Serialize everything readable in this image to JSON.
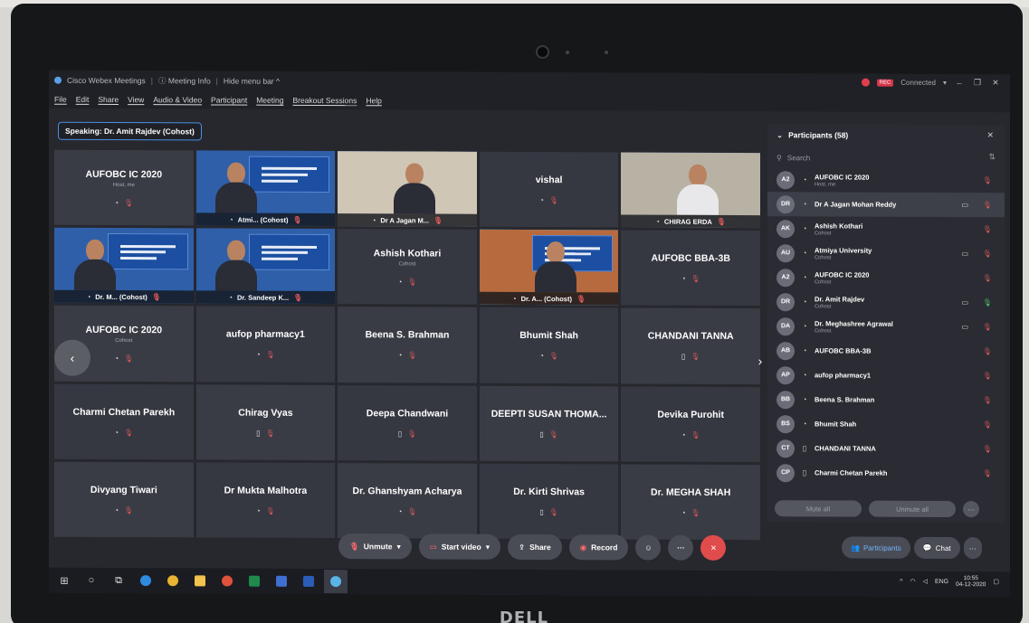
{
  "titlebar": {
    "app_name": "Cisco Webex Meetings",
    "meeting_info": "Meeting Info",
    "hide_menu_bar": "Hide menu bar",
    "connection_status": "Connected",
    "rec_badge": "REC"
  },
  "menubar": [
    "File",
    "Edit",
    "Share",
    "View",
    "Audio & Video",
    "Participant",
    "Meeting",
    "Breakout Sessions",
    "Help"
  ],
  "speaking_label": "Speaking: Dr. Amit Rajdev (Cohost)",
  "tiles": [
    {
      "name": "AUFOBC IC 2020",
      "sub": "Host, me",
      "kind": "avatar"
    },
    {
      "name": "Atmi... (Cohost)",
      "kind": "video"
    },
    {
      "name": "Dr A Jagan M...",
      "kind": "video"
    },
    {
      "name": "vishal",
      "kind": "avatar"
    },
    {
      "name": "CHIRAG ERDA",
      "kind": "video"
    },
    {
      "name": "Dr. M... (Cohost)",
      "kind": "video"
    },
    {
      "name": "Dr. Sandeep K...",
      "kind": "video"
    },
    {
      "name": "Ashish Kothari",
      "sub": "Cohost",
      "kind": "avatar"
    },
    {
      "name": "Dr. A... (Cohost)",
      "kind": "video"
    },
    {
      "name": "AUFOBC BBA-3B",
      "kind": "avatar"
    },
    {
      "name": "AUFOBC IC 2020",
      "sub": "Cohost",
      "kind": "avatar"
    },
    {
      "name": "aufop pharmacy1",
      "kind": "avatar"
    },
    {
      "name": "Beena S. Brahman",
      "kind": "avatar"
    },
    {
      "name": "Bhumit Shah",
      "kind": "avatar"
    },
    {
      "name": "CHANDANI TANNA",
      "kind": "avatar"
    },
    {
      "name": "Charmi Chetan Parekh",
      "kind": "avatar"
    },
    {
      "name": "Chirag Vyas",
      "kind": "avatar"
    },
    {
      "name": "Deepa Chandwani",
      "kind": "avatar"
    },
    {
      "name": "DEEPTI SUSAN THOMA...",
      "kind": "avatar"
    },
    {
      "name": "Devika Purohit",
      "kind": "avatar"
    },
    {
      "name": "Divyang Tiwari",
      "kind": "avatar"
    },
    {
      "name": "Dr Mukta Malhotra",
      "kind": "avatar"
    },
    {
      "name": "Dr. Ghanshyam Acharya",
      "kind": "avatar"
    },
    {
      "name": "Dr. Kirti Shrivas",
      "kind": "avatar"
    },
    {
      "name": "Dr. MEGHA SHAH",
      "kind": "avatar"
    }
  ],
  "panel": {
    "title": "Participants (58)",
    "search_placeholder": "Search",
    "mute_all": "Mute all",
    "unmute_all": "Unmute all",
    "participants": [
      {
        "initials": "A2",
        "name": "AUFOBC IC 2020",
        "role": "Host, me"
      },
      {
        "initials": "DR",
        "name": "Dr A Jagan Mohan Reddy",
        "role": ""
      },
      {
        "initials": "AK",
        "name": "Ashish Kothari",
        "role": "Cohost"
      },
      {
        "initials": "AU",
        "name": "Atmiya University",
        "role": "Cohost"
      },
      {
        "initials": "A2",
        "name": "AUFOBC IC 2020",
        "role": "Cohost"
      },
      {
        "initials": "DR",
        "name": "Dr. Amit Rajdev",
        "role": "Cohost"
      },
      {
        "initials": "DA",
        "name": "Dr. Meghashree Agrawal",
        "role": "Cohost"
      },
      {
        "initials": "AB",
        "name": "AUFOBC BBA-3B",
        "role": ""
      },
      {
        "initials": "AP",
        "name": "aufop pharmacy1",
        "role": ""
      },
      {
        "initials": "BB",
        "name": "Beena S. Brahman",
        "role": ""
      },
      {
        "initials": "BS",
        "name": "Bhumit Shah",
        "role": ""
      },
      {
        "initials": "CT",
        "name": "CHANDANI TANNA",
        "role": ""
      },
      {
        "initials": "CP",
        "name": "Charmi Chetan Parekh",
        "role": ""
      }
    ]
  },
  "controls": {
    "unmute": "Unmute",
    "start_video": "Start video",
    "share": "Share",
    "record": "Record",
    "participants_tab": "Participants",
    "chat_tab": "Chat"
  },
  "taskbar": {
    "language": "ENG",
    "time": "10:55",
    "date": "04-12-2020"
  },
  "brand": "DELL"
}
